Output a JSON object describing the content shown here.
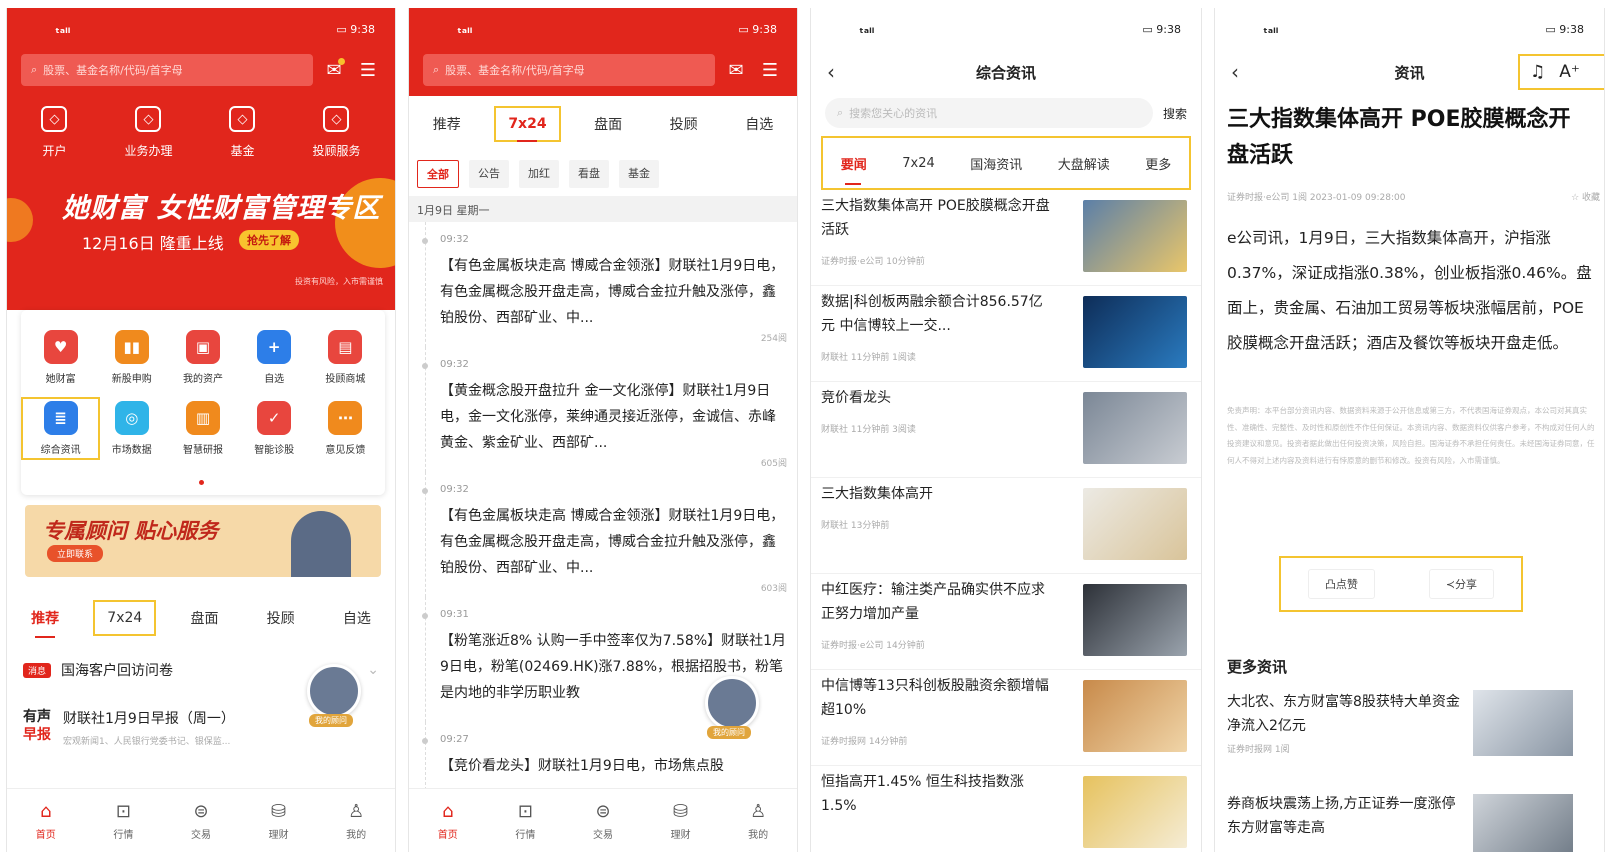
{
  "status": {
    "signal": "ₜₐₗₗ",
    "time": "9:38",
    "battery": "▭"
  },
  "screen1": {
    "search_placeholder": "股票、基金名称/代码/首字母",
    "quick": [
      {
        "icon": "user-plus-icon",
        "label": "开户"
      },
      {
        "icon": "service-icon",
        "label": "业务办理"
      },
      {
        "icon": "chart-icon",
        "label": "基金"
      },
      {
        "icon": "advisor-icon",
        "label": "投顾服务"
      }
    ],
    "banner": {
      "title": "她财富 女性财富管理专区",
      "sub": "12月16日 隆重上线",
      "button": "抢先了解",
      "risk": "投资有风险，入市需谨慎"
    },
    "grid": [
      {
        "label": "她财富",
        "color": "#e8463e",
        "glyph": "♥"
      },
      {
        "label": "新股申购",
        "color": "#f08a1d",
        "glyph": "▮▮"
      },
      {
        "label": "我的资产",
        "color": "#e8463e",
        "glyph": "▣"
      },
      {
        "label": "自选",
        "color": "#2d7ee8",
        "glyph": "+"
      },
      {
        "label": "投顾商城",
        "color": "#e8463e",
        "glyph": "▤"
      },
      {
        "label": "综合资讯",
        "color": "#2d7ee8",
        "glyph": "≣"
      },
      {
        "label": "市场数据",
        "color": "#2fb4e8",
        "glyph": "◎"
      },
      {
        "label": "智慧研报",
        "color": "#f08a1d",
        "glyph": "▥"
      },
      {
        "label": "智能诊股",
        "color": "#e8463e",
        "glyph": "✓"
      },
      {
        "label": "意见反馈",
        "color": "#f08a1d",
        "glyph": "⋯"
      }
    ],
    "advisor": {
      "title": "专属顾问 贴心服务",
      "button": "立即联系"
    },
    "tabs": [
      "推荐",
      "7x24",
      "盘面",
      "投顾",
      "自选"
    ],
    "notice": {
      "badge": "消息",
      "text": "国海客户回访问卷"
    },
    "morning": {
      "logo1": "有声",
      "logo2": "早报",
      "title": "财联社1月9日早报（周一）",
      "desc": "宏观新闻1、人民银行党委书记、银保监..."
    },
    "fab_label": "我的顾问"
  },
  "tabbar": [
    {
      "icon": "home-icon",
      "glyph": "⌂",
      "label": "首页"
    },
    {
      "icon": "market-icon",
      "glyph": "⊡",
      "label": "行情"
    },
    {
      "icon": "trade-icon",
      "glyph": "⊜",
      "label": "交易"
    },
    {
      "icon": "wealth-icon",
      "glyph": "⛁",
      "label": "理财"
    },
    {
      "icon": "profile-icon",
      "glyph": "♙",
      "label": "我的"
    }
  ],
  "screen2": {
    "chips": [
      "全部",
      "公告",
      "加红",
      "看盘",
      "基金"
    ],
    "date": "1月9日 星期一",
    "feed": [
      {
        "time": "09:32",
        "text": "【有色金属板块走高 博威合金领涨】财联社1月9日电，有色金属概念股开盘走高，博威合金拉升触及涨停，鑫铂股份、西部矿业、中...",
        "reads": "254阅"
      },
      {
        "time": "09:32",
        "text": "【黄金概念股开盘拉升 金一文化涨停】财联社1月9日电，金一文化涨停，莱绅通灵接近涨停，金诚信、赤峰黄金、紫金矿业、西部矿...",
        "reads": "605阅"
      },
      {
        "time": "09:32",
        "text": "【有色金属板块走高 博威合金领涨】财联社1月9日电，有色金属概念股开盘走高，博威合金拉升触及涨停，鑫铂股份、西部矿业、中...",
        "reads": "603阅"
      },
      {
        "time": "09:31",
        "text": "【粉笔涨近8% 认购一手中签率仅为7.58%】财联社1月9日电，粉笔(02469.HK)涨7.88%，根据招股书，粉笔是内地的非学历职业教",
        "reads": ""
      },
      {
        "time": "09:27",
        "text": "【竞价看龙头】财联社1月9日电，市场焦点股",
        "reads": ""
      }
    ]
  },
  "screen3": {
    "title": "综合资讯",
    "search_placeholder": "搜索您关心的资讯",
    "search_button": "搜索",
    "tabs": [
      "要闻",
      "7x24",
      "国海资讯",
      "大盘解读",
      "更多"
    ],
    "news": [
      {
        "title": "三大指数集体高开 POE胶膜概念开盘活跃",
        "meta": "证券时报·e公司  10分钟前",
        "c1": "#5b7fa8",
        "c2": "#e9c66a"
      },
      {
        "title": "数据|科创板两融余额合计856.57亿元 中信博较上一交...",
        "meta": "财联社  11分钟前  1阅读",
        "c1": "#0e2d58",
        "c2": "#2a7bc0"
      },
      {
        "title": "竞价看龙头",
        "meta": "财联社  11分钟前  3阅读",
        "c1": "#7b8796",
        "c2": "#c8ccd2"
      },
      {
        "title": "三大指数集体高开",
        "meta": "财联社  13分钟前",
        "c1": "#eceae4",
        "c2": "#d9c49a"
      },
      {
        "title": "中红医疗：输注类产品确实供不应求 正努力增加产量",
        "meta": "证券时报·e公司  14分钟前",
        "c1": "#2d3138",
        "c2": "#9aa3ad"
      },
      {
        "title": "中信博等13只科创板股融资余额增幅超10%",
        "meta": "证券时报网  14分钟前",
        "c1": "#c88a4a",
        "c2": "#f0d5a8"
      },
      {
        "title": "恒指高开1.45% 恒生科技指数涨1.5%",
        "meta": "",
        "c1": "#e6c25e",
        "c2": "#f5ecd4"
      }
    ]
  },
  "screen4": {
    "title": "资讯",
    "article_title": "三大指数集体高开 POE胶膜概念开盘活跃",
    "meta": "证券时报·e公司  1阅  2023-01-09 09:28:00",
    "fav": "☆ 收藏",
    "body": "e公司讯，1月9日，三大指数集体高开，沪指涨0.37%，深证成指涨0.38%，创业板指涨0.46%。盘面上，贵金属、石油加工贸易等板块涨幅居前，POE胶膜概念开盘活跃；酒店及餐饮等板块开盘走低。",
    "disclaimer": "免责声明：本平台部分资讯内容、数据资料来源于公开信息或第三方，不代表国海证券观点，本公司对其真实性、准确性、完整性、及时性和原创性不作任何保证。本资讯内容、数据资料仅供客户参考，不构成对任何人的投资建议和意见。投资者据此做出任何投资决策，风险自担。国海证券不承担任何责任。未经国海证券同意，任何人不得对上述内容及资料进行有悖原意的删节和修改。投资有风险，入市需谨慎。",
    "like": "凸点赞",
    "share": "≺分享",
    "more": "更多资讯",
    "related": [
      {
        "title": "大北农、东方财富等8股获特大单资金净流入2亿元",
        "meta": "证券时报网  1阅"
      },
      {
        "title": "券商板块震荡上扬,方正证券一度涨停 东方财富等走高",
        "meta": ""
      }
    ]
  }
}
